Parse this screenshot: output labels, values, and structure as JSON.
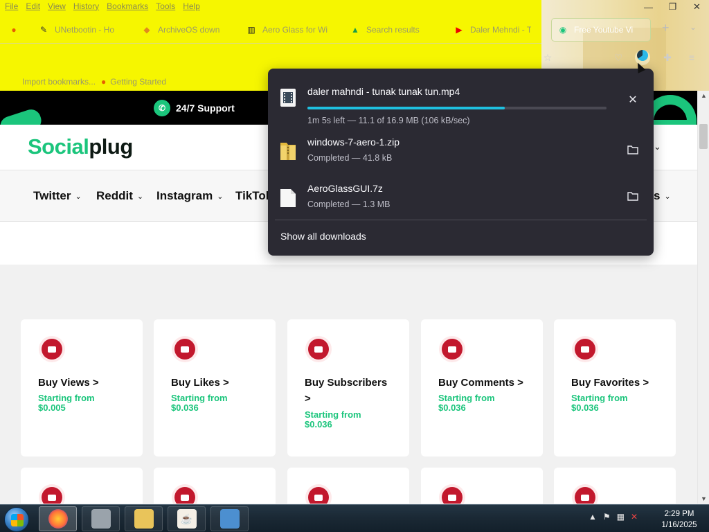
{
  "menu": [
    "File",
    "Edit",
    "View",
    "History",
    "Bookmarks",
    "Tools",
    "Help"
  ],
  "window_controls": {
    "minimize": "—",
    "restore": "❐",
    "close": "✕"
  },
  "tabs": [
    {
      "icon": "firefox-icon",
      "label": ""
    },
    {
      "icon": "unetbootin-icon",
      "label": "UNetbootin - Ho"
    },
    {
      "icon": "archiveos-icon",
      "label": "ArchiveOS down"
    },
    {
      "icon": "archive-org-icon",
      "label": "Aero Glass for Wi"
    },
    {
      "icon": "google-drive-icon",
      "label": "Search results"
    },
    {
      "icon": "youtube-icon",
      "label": "Daler Mehndi - T"
    },
    {
      "icon": "youtube-video-icon",
      "label": "Free Youtube Vi"
    }
  ],
  "tab_controls": {
    "new_tab": "+",
    "list_all": "⌄"
  },
  "bookmarks": [
    {
      "label": "Import bookmarks..."
    },
    {
      "label": "Getting Started"
    }
  ],
  "site": {
    "support": "24/7 Support",
    "logo_a": "Social",
    "logo_b": "plug",
    "nav": [
      "Twitter",
      "Reddit",
      "Instagram",
      "TikTok",
      "s"
    ],
    "cards": [
      {
        "title": "Buy Views >",
        "sub_label": "Starting from",
        "price": "$0.005"
      },
      {
        "title": "Buy Likes >",
        "sub_label": "Starting from",
        "price": "$0.036"
      },
      {
        "title": "Buy Subscribers >",
        "sub_label": "Starting from",
        "price": "$0.036"
      },
      {
        "title": "Buy Comments >",
        "sub_label": "Starting from",
        "price": "$0.036"
      },
      {
        "title": "Buy Favorites >",
        "sub_label": "Starting from",
        "price": "$0.036"
      }
    ]
  },
  "downloads": {
    "items": [
      {
        "name": "daler mahndi - tunak tunak tun.mp4",
        "status": "1m 5s left — 11.1 of 16.9 MB (106 kB/sec)",
        "progress": 0.66,
        "action": "✕",
        "file_icon": "video-file-icon"
      },
      {
        "name": "windows-7-aero-1.zip",
        "status": "Completed — 41.8 kB",
        "file_icon": "zip-folder-icon"
      },
      {
        "name": "AeroGlassGUI.7z",
        "status": "Completed — 1.3 MB",
        "file_icon": "blank-file-icon"
      }
    ],
    "show_all": "Show all downloads"
  },
  "taskbar": {
    "apps": [
      "firefox",
      "scanner",
      "file-explorer",
      "java",
      "remote-desktop"
    ],
    "time": "2:29 PM",
    "date": "1/16/2025"
  },
  "colors": {
    "chrome_yellow": "#f6f600",
    "brand_green": "#1bc57c",
    "panel_bg": "#2b2a33",
    "progress": "#1fc0e0",
    "youtube_red": "#c2182d"
  }
}
